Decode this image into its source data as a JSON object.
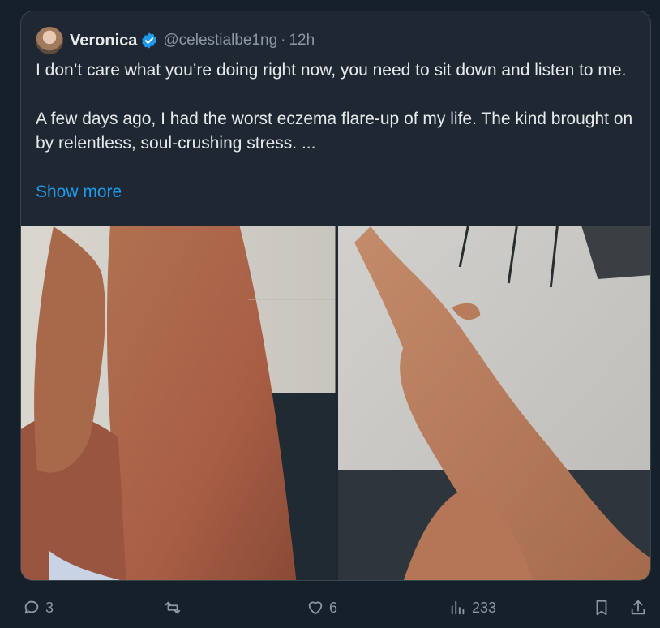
{
  "tweet": {
    "display_name": "Veronica",
    "handle": "@celestialbe1ng",
    "separator": "·",
    "time": "12h",
    "text": "I don’t care what you’re doing right now, you need to sit down and listen to me.\n\nA few days ago, I had the worst eczema flare-up of my life. The kind brought on by relentless, soul-crushing stress. ...",
    "show_more": "Show more"
  },
  "actions": {
    "reply_count": "3",
    "retweet_count": "",
    "like_count": "6",
    "views_count": "233"
  },
  "colors": {
    "background": "#15202b",
    "card": "#1e2732",
    "accent": "#1d9bf0",
    "muted": "#8b98a5"
  },
  "icons": [
    "verified-badge-icon",
    "reply-icon",
    "retweet-icon",
    "like-icon",
    "views-icon",
    "bookmark-icon",
    "share-icon"
  ]
}
